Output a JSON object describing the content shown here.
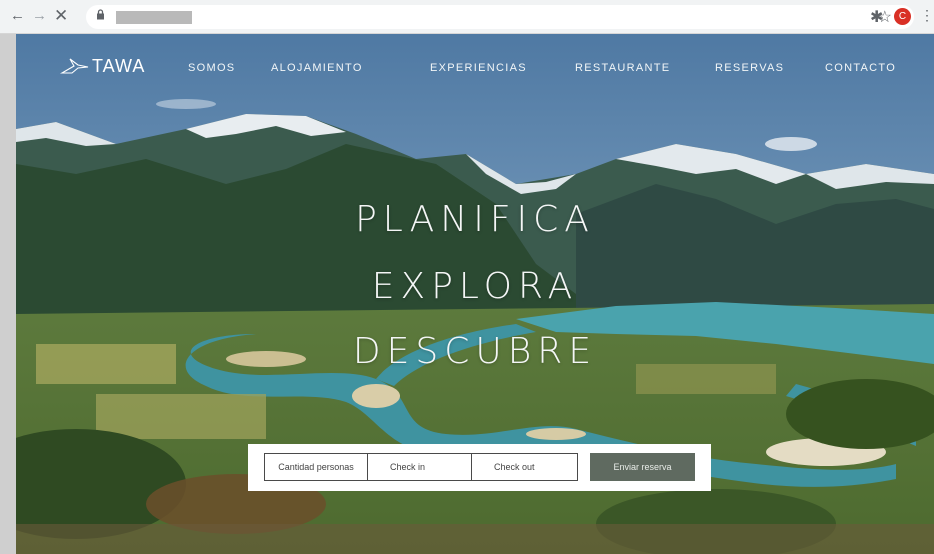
{
  "browser": {
    "back_glyph": "←",
    "forward_glyph": "→",
    "stop_glyph": "✕",
    "lock_icon": "lock-icon",
    "star_glyph": "☆",
    "extensions_glyph": "✱",
    "profile_initial": "C",
    "menu_glyph": "⋮"
  },
  "site": {
    "logo_text": "TAWA",
    "nav": [
      "SOMOS",
      "ALOJAMIENTO",
      "EXPERIENCIAS",
      "RESTAURANTE",
      "RESERVAS",
      "CONTACTO"
    ]
  },
  "hero": {
    "lines": [
      "PLANIFICA",
      "EXPLORA",
      "DESCUBRE"
    ]
  },
  "booking": {
    "guests_label": "Cantidad personas",
    "checkin_label": "Check in",
    "checkout_label": "Check out",
    "submit_label": "Enviar reserva"
  },
  "colors": {
    "accent": "#5f6a60",
    "profile": "#d93025"
  }
}
